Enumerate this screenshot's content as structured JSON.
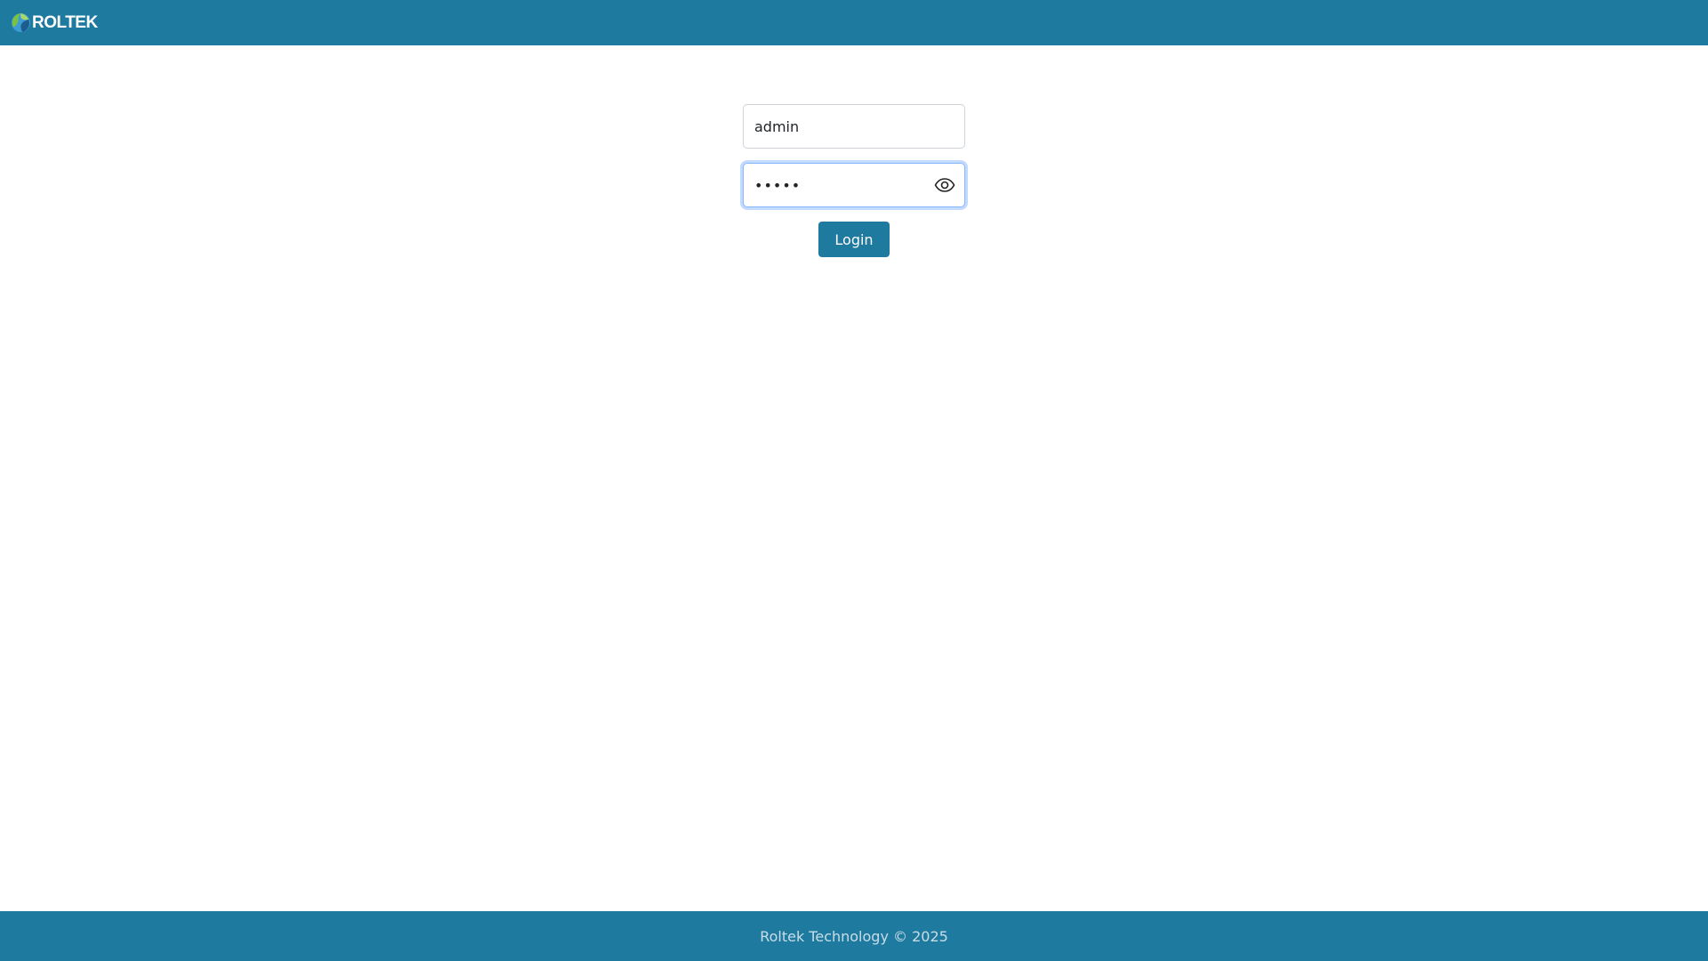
{
  "header": {
    "brand": "ROLTEK",
    "logo_icon": "roltek-globe-logo"
  },
  "login": {
    "username_value": "admin",
    "password_value": "•••••",
    "show_password_icon": "eye-icon",
    "submit_label": "Login"
  },
  "footer": {
    "copyright": "Roltek Technology © 2025"
  },
  "colors": {
    "brand": "#1f7a9f",
    "focus_border": "#86b7fe",
    "input_border": "#ced4da"
  }
}
